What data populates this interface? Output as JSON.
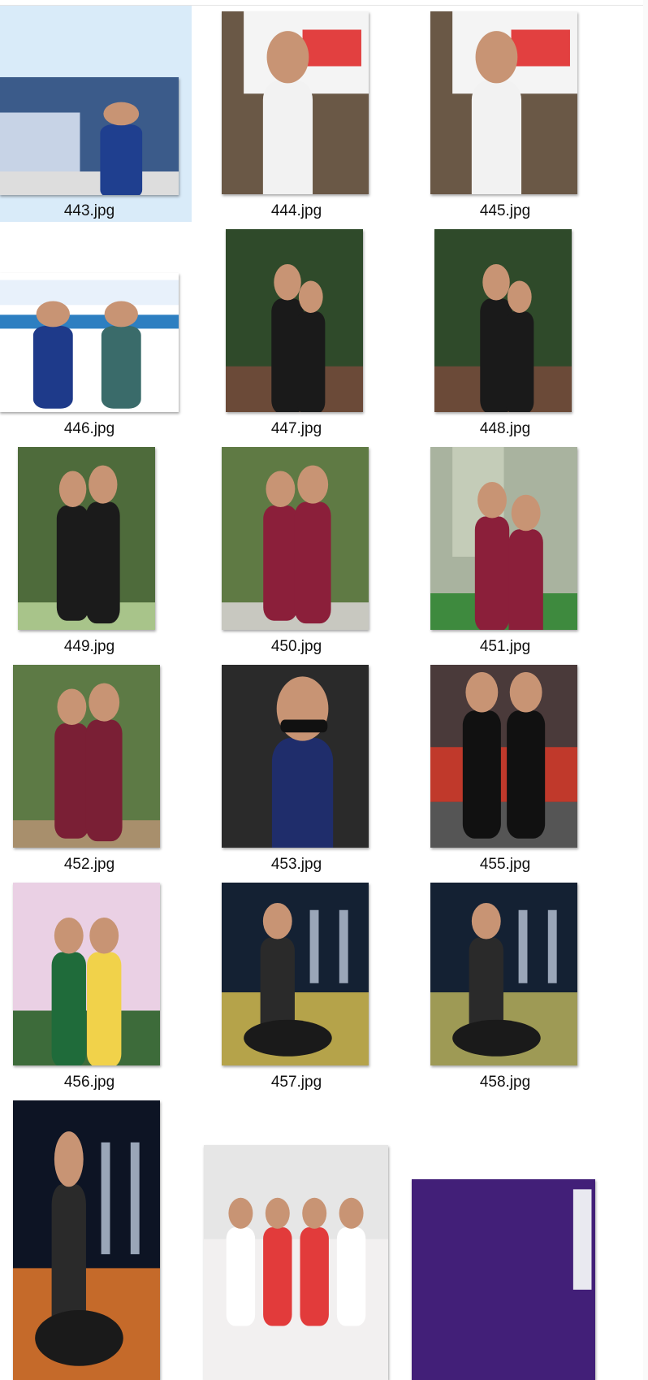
{
  "selected_file": "443.jpg",
  "files": [
    {
      "name": "443.jpg",
      "icon": "radio-dj-photo-icon",
      "scene": "studio",
      "bg": "#3b5b8a",
      "fg": "#1f3f8f",
      "acc": "#c7d3e6"
    },
    {
      "name": "444.jpg",
      "icon": "radio-dj-photo-icon",
      "scene": "portrait",
      "bg": "#6a5846",
      "fg": "#f2f2f2",
      "acc": "#e24040"
    },
    {
      "name": "445.jpg",
      "icon": "radio-dj-photo-icon",
      "scene": "portrait",
      "bg": "#6a5846",
      "fg": "#f2f2f2",
      "acc": "#e24040"
    },
    {
      "name": "446.jpg",
      "icon": "event-banner-photo-icon",
      "scene": "banner",
      "bg": "#ffffff",
      "fg": "#1e3a8a",
      "acc": "#2d7fc1"
    },
    {
      "name": "447.jpg",
      "icon": "family-photo-icon",
      "scene": "forest",
      "bg": "#2f4a2a",
      "fg": "#1a1a1a",
      "acc": "#6b4a38"
    },
    {
      "name": "448.jpg",
      "icon": "family-photo-icon",
      "scene": "forest",
      "bg": "#2f4a2a",
      "fg": "#1a1a1a",
      "acc": "#6b4a38"
    },
    {
      "name": "449.jpg",
      "icon": "couple-photo-icon",
      "scene": "garden",
      "bg": "#4e6b3b",
      "fg": "#1b1b1b",
      "acc": "#a8c48a"
    },
    {
      "name": "450.jpg",
      "icon": "couple-photo-icon",
      "scene": "garden",
      "bg": "#5f7a44",
      "fg": "#8b1f3a",
      "acc": "#c8c8c0"
    },
    {
      "name": "451.jpg",
      "icon": "couple-photo-icon",
      "scene": "door",
      "bg": "#a9b39f",
      "fg": "#8b1f3a",
      "acc": "#3e8a3e"
    },
    {
      "name": "452.jpg",
      "icon": "family-photo-icon",
      "scene": "garden",
      "bg": "#5d7a45",
      "fg": "#7a1f35",
      "acc": "#a88f6c"
    },
    {
      "name": "453.jpg",
      "icon": "selfie-photo-icon",
      "scene": "selfie",
      "bg": "#2a2a2a",
      "fg": "#1f2d6b",
      "acc": "#c8a080"
    },
    {
      "name": "455.jpg",
      "icon": "stage-photo-icon",
      "scene": "stage",
      "bg": "#4a3a3a",
      "fg": "#111111",
      "acc": "#c0392b"
    },
    {
      "name": "456.jpg",
      "icon": "event-banner-photo-icon",
      "scene": "event",
      "bg": "#ead0e4",
      "fg": "#1f6b3a",
      "acc": "#f1d24a"
    },
    {
      "name": "457.jpg",
      "icon": "motorcycle-photo-icon",
      "scene": "night",
      "bg": "#142133",
      "fg": "#2a2a2a",
      "acc": "#b5a34a"
    },
    {
      "name": "458.jpg",
      "icon": "motorcycle-photo-icon",
      "scene": "night",
      "bg": "#142133",
      "fg": "#2a2a2a",
      "acc": "#9e9a55"
    },
    {
      "name": "",
      "icon": "group-motorcycle-photo-icon",
      "scene": "night",
      "bg": "#0d1424",
      "fg": "#2a2a2a",
      "acc": "#c56a2a"
    },
    {
      "name": "",
      "icon": "wedding-group-photo-icon",
      "scene": "wedding",
      "bg": "#f2f0f0",
      "fg": "#ffffff",
      "acc": "#e23b3b"
    },
    {
      "name": "",
      "icon": "concert-photo-icon",
      "scene": "concert",
      "bg": "#2a1050",
      "fg": "#5a2da0",
      "acc": "#e9e9f0"
    }
  ]
}
